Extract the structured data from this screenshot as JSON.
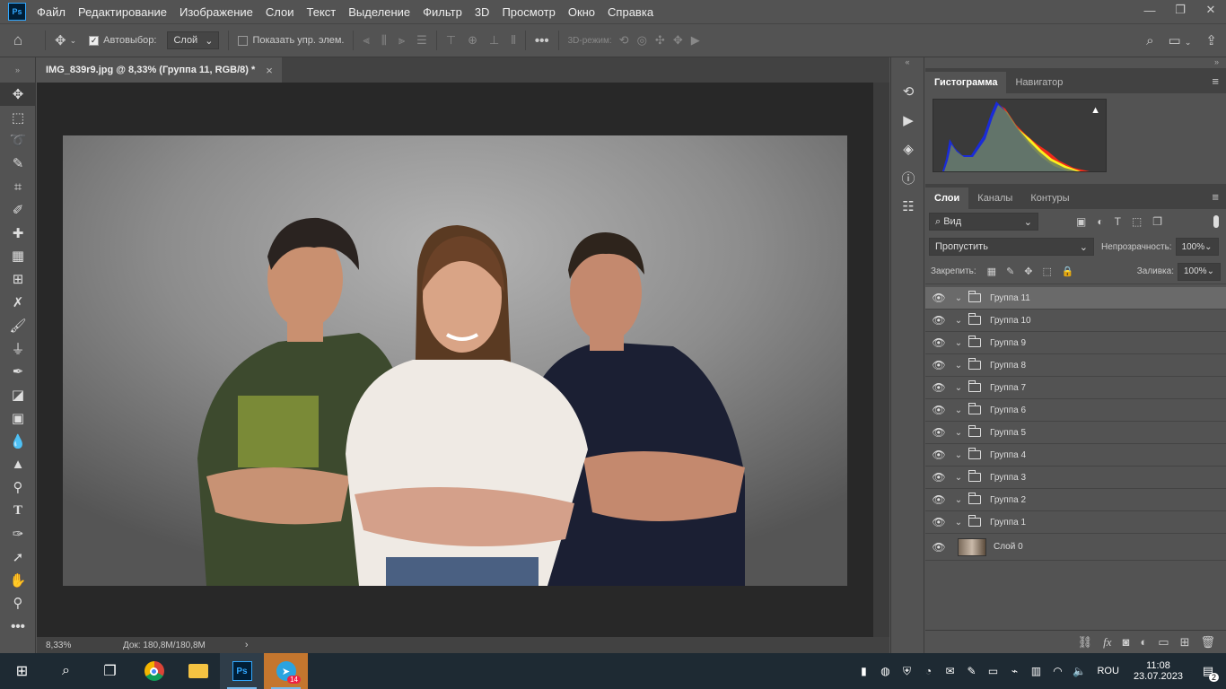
{
  "app": {
    "logo_text": "Ps"
  },
  "menu": [
    "Файл",
    "Редактирование",
    "Изображение",
    "Слои",
    "Текст",
    "Выделение",
    "Фильтр",
    "3D",
    "Просмотр",
    "Окно",
    "Справка"
  ],
  "window_controls": {
    "minimize": "—",
    "restore": "❐",
    "close": "✕"
  },
  "options": {
    "autoselect_label": "Автовыбор:",
    "autoselect_value": "Слой",
    "show_controls_label": "Показать упр. элем.",
    "mode_3d_label": "3D-режим:"
  },
  "document": {
    "tab_title": "IMG_839r9.jpg @ 8,33% (Группа 11, RGB/8) *",
    "close_symbol": "×",
    "zoom": "8,33%",
    "doc_size": "Док: 180,8M/180,8M"
  },
  "panels": {
    "histogram_tabs": [
      "Гистограмма",
      "Навигатор"
    ],
    "layers_tabs": [
      "Слои",
      "Каналы",
      "Контуры"
    ],
    "filter_kind": "Вид",
    "blend_mode": "Пропустить",
    "opacity_label": "Непрозрачность:",
    "opacity_value": "100%",
    "lock_label": "Закрепить:",
    "fill_label": "Заливка:",
    "fill_value": "100%",
    "warning_symbol": "▲"
  },
  "layers": [
    {
      "name": "Группа 11",
      "selected": true
    },
    {
      "name": "Группа 10"
    },
    {
      "name": "Группа 9"
    },
    {
      "name": "Группа 8"
    },
    {
      "name": "Группа 7"
    },
    {
      "name": "Группа 6"
    },
    {
      "name": "Группа 5"
    },
    {
      "name": "Группа 4"
    },
    {
      "name": "Группа 3"
    },
    {
      "name": "Группа 2"
    },
    {
      "name": "Группа 1"
    },
    {
      "name": "Слой 0",
      "type": "pixel"
    }
  ],
  "taskbar": {
    "telegram_badge": "14",
    "language": "ROU",
    "time": "11:08",
    "date": "23.07.2023",
    "notifications": "2"
  },
  "colors": {
    "accent": "#31a8ff",
    "panel": "#535353",
    "canvas_bg": "#282828",
    "taskbar": "#1e2a33"
  }
}
